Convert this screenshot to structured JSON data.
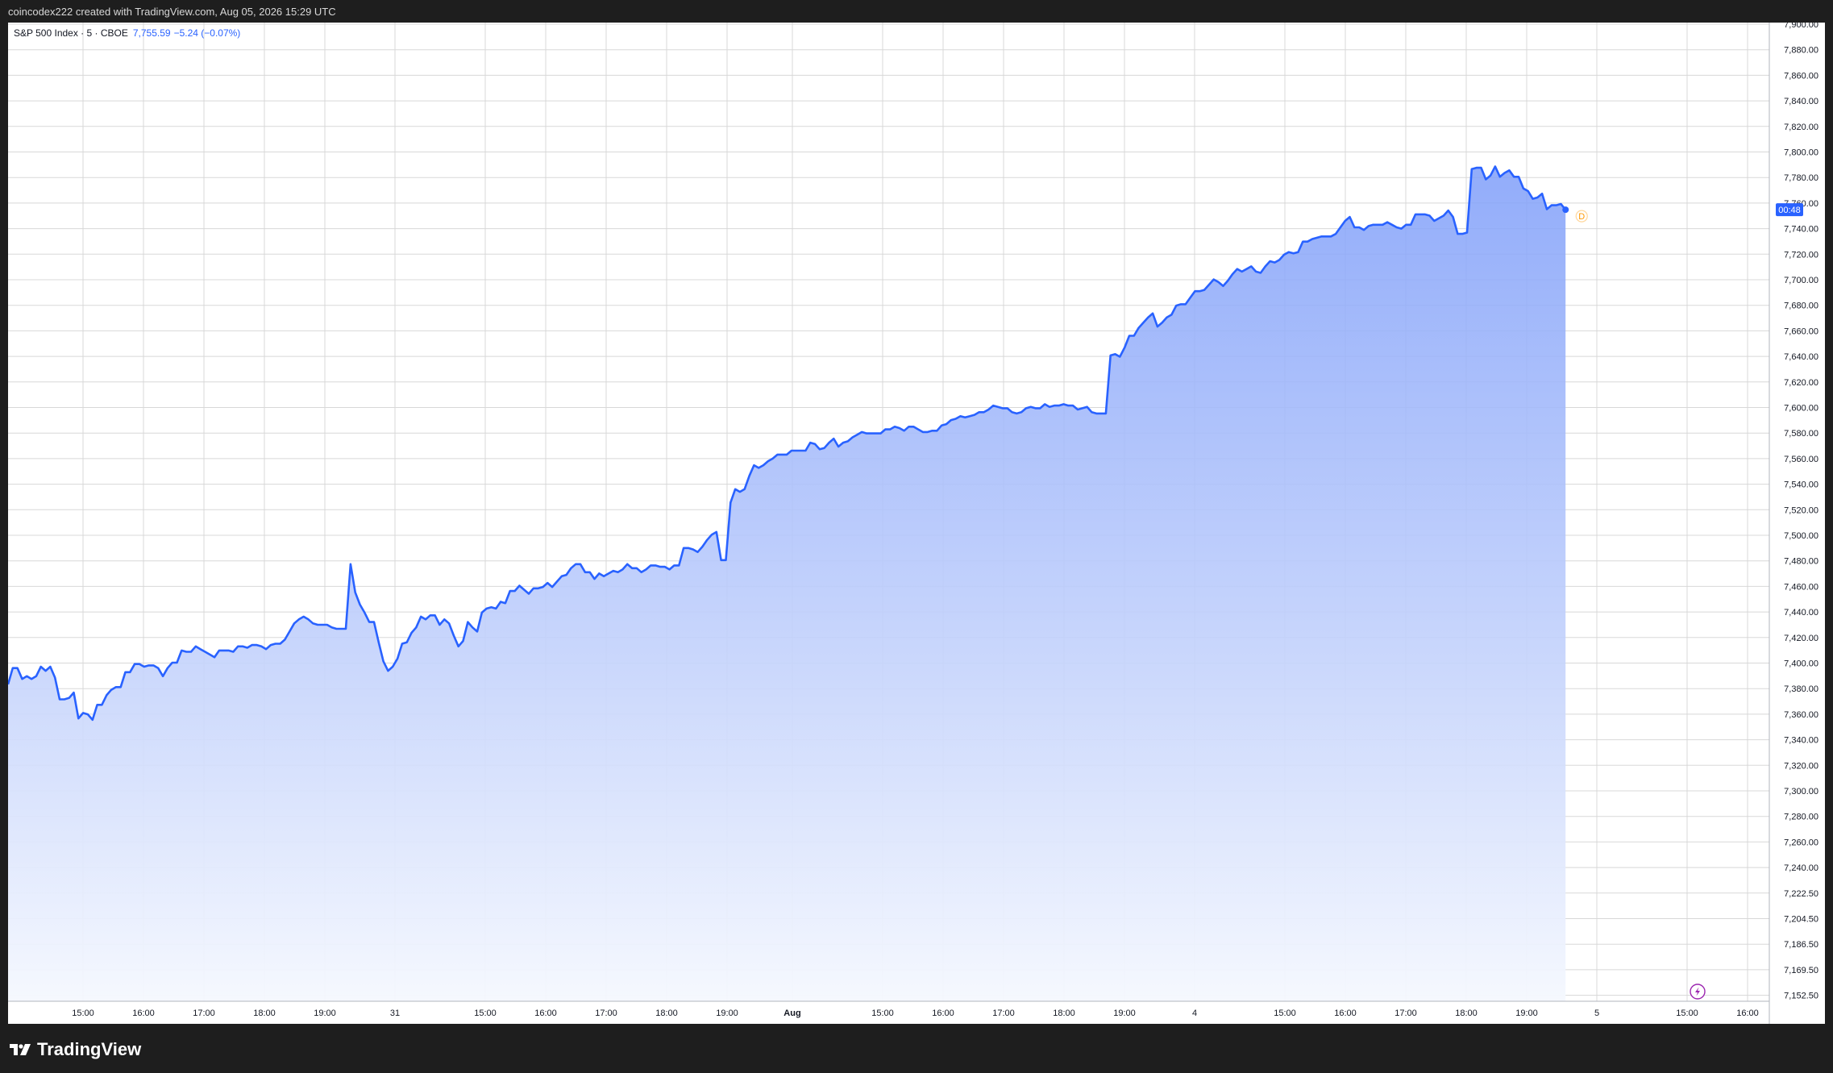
{
  "header": {
    "credit": "coincodex222 created with TradingView.com, Aug 05, 2026 15:29 UTC"
  },
  "legend": {
    "symbol": "S&P 500 Index · 5 · CBOE",
    "price": "7,755.59",
    "change": "−5.24 (−0.07%)"
  },
  "last_price_badge": {
    "label": "00:48"
  },
  "dividend_marker": {
    "label": "D"
  },
  "brand": {
    "name": "TradingView"
  },
  "icons": {
    "logo": "tradingview-logo-icon",
    "replay": "lightning-icon"
  },
  "colors": {
    "line": "#2962ff",
    "fill_top": "#7f9ef9",
    "fill_bottom": "#f5f8fe",
    "grid": "#d8d8d8",
    "axis_text": "#131722",
    "badge": "#2962ff",
    "dividend": "#ff9800"
  },
  "chart_data": {
    "type": "area",
    "title": "S&P 500 Index · 5 · CBOE",
    "xlabel": "",
    "ylabel": "",
    "x_tick_labels": [
      "15:00",
      "16:00",
      "17:00",
      "18:00",
      "19:00",
      "31",
      "15:00",
      "16:00",
      "17:00",
      "18:00",
      "19:00",
      "Aug",
      "15:00",
      "16:00",
      "17:00",
      "18:00",
      "19:00",
      "4",
      "15:00",
      "16:00",
      "17:00",
      "18:00",
      "19:00",
      "5",
      "15:00",
      "16:00"
    ],
    "y_tick_labels": [
      "7,900.00",
      "7,880.00",
      "7,860.00",
      "7,840.00",
      "7,820.00",
      "7,800.00",
      "7,780.00",
      "7,760.00",
      "7,740.00",
      "7,720.00",
      "7,700.00",
      "7,680.00",
      "7,660.00",
      "7,640.00",
      "7,620.00",
      "7,600.00",
      "7,580.00",
      "7,560.00",
      "7,540.00",
      "7,520.00",
      "7,500.00",
      "7,480.00",
      "7,460.00",
      "7,440.00",
      "7,420.00",
      "7,400.00",
      "7,380.00",
      "7,360.00",
      "7,340.00",
      "7,320.00",
      "7,300.00",
      "7,280.00",
      "7,260.00",
      "7,240.00",
      "7,222.50",
      "7,204.50",
      "7,186.50",
      "7,169.50",
      "7,152.50"
    ],
    "grid": true,
    "series": [
      {
        "values": [
          7398,
          7410,
          7410,
          7402,
          7404,
          7402,
          7404,
          7411,
          7408,
          7411,
          7403,
          7387,
          7387,
          7388,
          7392,
          7373,
          7377,
          7376,
          7372,
          7383,
          7383,
          7390,
          7394,
          7396,
          7396,
          7407,
          7407,
          7413,
          7413,
          7411,
          7412,
          7412,
          7410,
          7404,
          7410,
          7414,
          7414,
          7423,
          7422,
          7422,
          7426,
          7424,
          7422,
          7420,
          7418,
          7423,
          7423,
          7423,
          7422,
          7426,
          7426,
          7425,
          7427,
          7427,
          7426,
          7424,
          7427,
          7428,
          7428,
          7431,
          7437,
          7443,
          7446,
          7448,
          7446,
          7443,
          7442,
          7442,
          7442,
          7440,
          7439,
          7439,
          7439,
          7487,
          7466,
          7457,
          7451,
          7444,
          7444,
          7429,
          7415,
          7408,
          7411,
          7417,
          7428,
          7429,
          7436,
          7440,
          7448,
          7446,
          7449,
          7449,
          7442,
          7446,
          7443,
          7434,
          7426,
          7430,
          7444,
          7440,
          7437,
          7451,
          7454,
          7455,
          7454,
          7459,
          7458,
          7467,
          7467,
          7471,
          7468,
          7465,
          7469,
          7469,
          7470,
          7473,
          7470,
          7474,
          7478,
          7479,
          7484,
          7487,
          7487,
          7481,
          7481,
          7476,
          7480,
          7478,
          7480,
          7482,
          7481,
          7483,
          7487,
          7484,
          7484,
          7481,
          7483,
          7486,
          7486,
          7485,
          7485,
          7483,
          7486,
          7486,
          7499,
          7499,
          7498,
          7496,
          7500,
          7505,
          7509,
          7511,
          7490,
          7490,
          7533,
          7543,
          7541,
          7543,
          7553,
          7561,
          7559,
          7561,
          7564,
          7566,
          7569,
          7569,
          7569,
          7572,
          7572,
          7572,
          7572,
          7578,
          7577,
          7573,
          7574,
          7578,
          7581,
          7575,
          7578,
          7579,
          7582,
          7584,
          7586,
          7585,
          7585,
          7585,
          7585,
          7588,
          7588,
          7590,
          7589,
          7587,
          7590,
          7590,
          7588,
          7586,
          7586,
          7587,
          7587,
          7591,
          7592,
          7595,
          7596,
          7598,
          7597,
          7598,
          7599,
          7601,
          7601,
          7603,
          7606,
          7605,
          7604,
          7604,
          7601,
          7600,
          7601,
          7604,
          7605,
          7604,
          7604,
          7607,
          7605,
          7606,
          7606,
          7607,
          7606,
          7606,
          7603,
          7604,
          7605,
          7601,
          7600,
          7600,
          7600,
          7644,
          7645,
          7643,
          7650,
          7659,
          7659,
          7665,
          7669,
          7673,
          7676,
          7666,
          7669,
          7673,
          7675,
          7682,
          7683,
          7683,
          7688,
          7693,
          7693,
          7694,
          7698,
          7702,
          7700,
          7697,
          7701,
          7706,
          7710,
          7708,
          7710,
          7712,
          7708,
          7707,
          7712,
          7716,
          7715,
          7717,
          7721,
          7723,
          7722,
          7723,
          7731,
          7731,
          7733,
          7734,
          7735,
          7735,
          7735,
          7737,
          7742,
          7747,
          7750,
          7742,
          7742,
          7740,
          7743,
          7744,
          7744,
          7744,
          7746,
          7744,
          7742,
          7741,
          7744,
          7744,
          7752,
          7752,
          7752,
          7751,
          7747,
          7749,
          7751,
          7755,
          7750,
          7737,
          7737,
          7738,
          7787,
          7788,
          7788,
          7779,
          7782,
          7789,
          7781,
          7784,
          7786,
          7781,
          7781,
          7772,
          7770,
          7764,
          7765,
          7768,
          7756,
          7759,
          7759,
          7760,
          7755.59
        ]
      }
    ],
    "ylim": [
      7145,
      7900
    ],
    "y_scale": "log"
  }
}
